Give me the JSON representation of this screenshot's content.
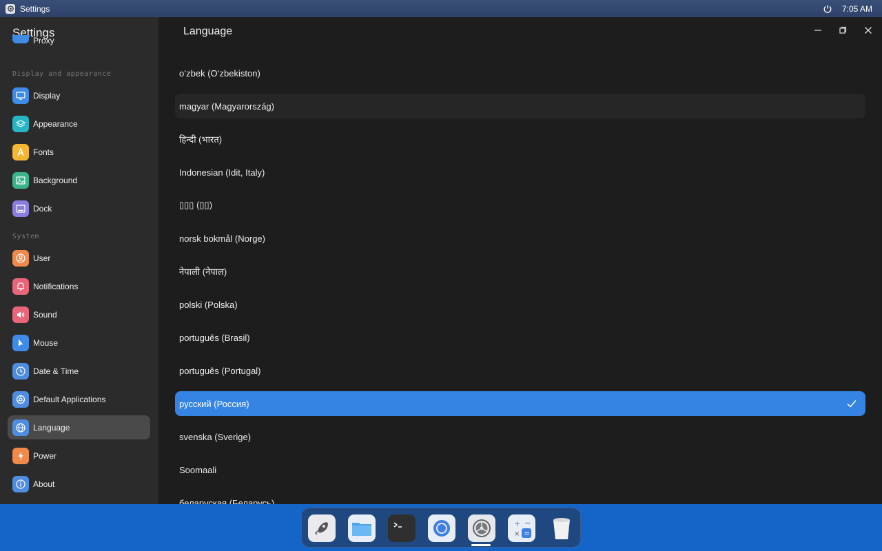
{
  "topbar": {
    "app_name": "Settings",
    "time": "7:05 AM"
  },
  "sidebar": {
    "title": "Settings",
    "partial_item": {
      "label": "Proxy",
      "icon": "proxy-icon"
    },
    "section_display": "Display and appearance",
    "section_system": "System",
    "items": [
      {
        "label": "Display",
        "icon": "display-icon",
        "color": "#3f8ce8"
      },
      {
        "label": "Appearance",
        "icon": "appearance-icon",
        "color": "#27b5c4"
      },
      {
        "label": "Fonts",
        "icon": "fonts-icon",
        "color": "#f5b731"
      },
      {
        "label": "Background",
        "icon": "background-icon",
        "color": "#3bb58a"
      },
      {
        "label": "Dock",
        "icon": "dock-icon",
        "color": "#8a7fe0"
      },
      {
        "label": "User",
        "icon": "user-icon",
        "color": "#f08a4b"
      },
      {
        "label": "Notifications",
        "icon": "notifications-icon",
        "color": "#e9667a"
      },
      {
        "label": "Sound",
        "icon": "sound-icon",
        "color": "#e9667a"
      },
      {
        "label": "Mouse",
        "icon": "mouse-icon",
        "color": "#3f8ce8"
      },
      {
        "label": "Date & Time",
        "icon": "clock-icon",
        "color": "#4f8de0"
      },
      {
        "label": "Default Applications",
        "icon": "default-apps-icon",
        "color": "#4f8de0"
      },
      {
        "label": "Language",
        "icon": "globe-icon",
        "color": "#4f8de0"
      },
      {
        "label": "Power",
        "icon": "power-icon",
        "color": "#f08a4b"
      },
      {
        "label": "About",
        "icon": "info-icon",
        "color": "#4f8de0"
      }
    ],
    "active_item": "Language"
  },
  "content": {
    "title": "Language",
    "languages": [
      "o‘zbek (O‘zbekiston)",
      "magyar (Magyarország)",
      "हिन्दी (भारत)",
      "Indonesian (Idit, Italy)",
      "▯▯▯ (▯▯)",
      "norsk bokmål (Norge)",
      "नेपाली (नेपाल)",
      "polski (Polska)",
      "português (Brasil)",
      "português (Portugal)",
      "русский (Россия)",
      "svenska (Sverige)",
      "Soomaali",
      "беларуская (Беларусь)"
    ],
    "selected": "русский (Россия)",
    "hovered": "magyar (Magyarország)"
  },
  "dock": {
    "apps": [
      {
        "name": "launcher",
        "icon": "rocket-icon"
      },
      {
        "name": "files",
        "icon": "folder-icon"
      },
      {
        "name": "terminal",
        "icon": "terminal-icon"
      },
      {
        "name": "browser",
        "icon": "browser-icon"
      },
      {
        "name": "settings",
        "icon": "settings-icon"
      },
      {
        "name": "calculator",
        "icon": "calculator-icon"
      },
      {
        "name": "trash",
        "icon": "trash-icon"
      }
    ]
  },
  "colors": {
    "accent": "#3584e4",
    "sidebar_bg": "#2b2b2b",
    "content_bg": "#1d1d1d",
    "desktop": "#1565c8"
  }
}
